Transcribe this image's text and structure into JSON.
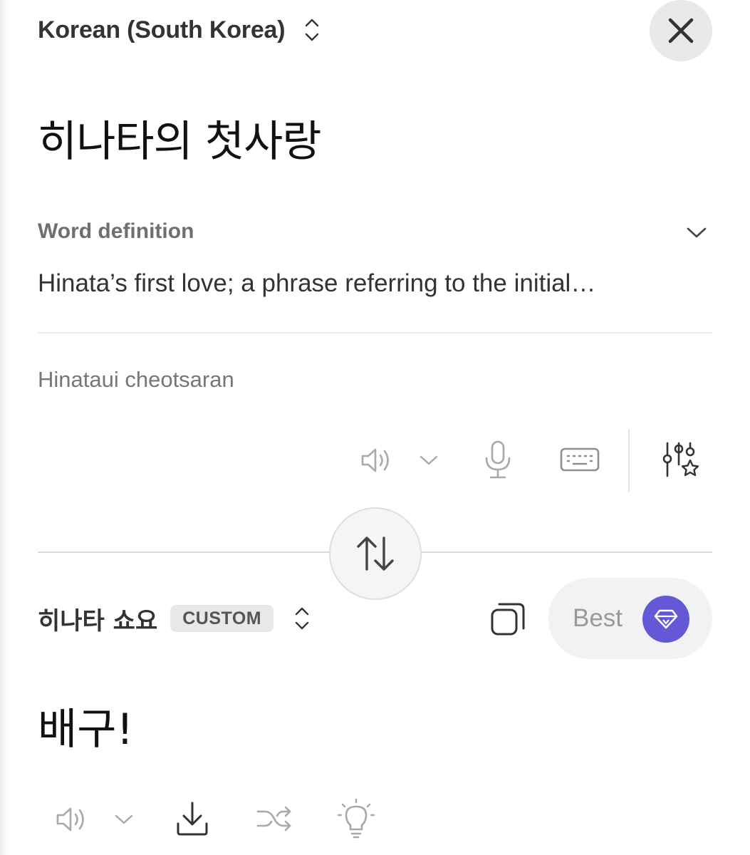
{
  "source": {
    "language": "Korean (South Korea)",
    "text": "히나타의 첫사랑",
    "definition_label": "Word definition",
    "definition_text": "Hinata’s first love; a phrase referring to the initial…",
    "transliteration": "Hinataui cheotsaran"
  },
  "target": {
    "language": "히나타 쇼요",
    "badge": "CUSTOM",
    "best_label": "Best",
    "text": "배구!"
  },
  "icons": {
    "source_toolbar": [
      "speaker-icon",
      "chevron-down-icon",
      "microphone-icon",
      "keyboard-icon",
      "settings-sliders-star-icon"
    ],
    "target_toolbar": [
      "speaker-icon",
      "chevron-down-icon",
      "download-icon",
      "shuffle-icon",
      "lightbulb-icon"
    ],
    "other": [
      "close-icon",
      "swap-icon",
      "copy-icon",
      "gem-icon",
      "updown-icon"
    ]
  },
  "colors": {
    "accent": "#6458d6",
    "icon_gray": "#a8a8ad",
    "icon_dark": "#333333"
  }
}
